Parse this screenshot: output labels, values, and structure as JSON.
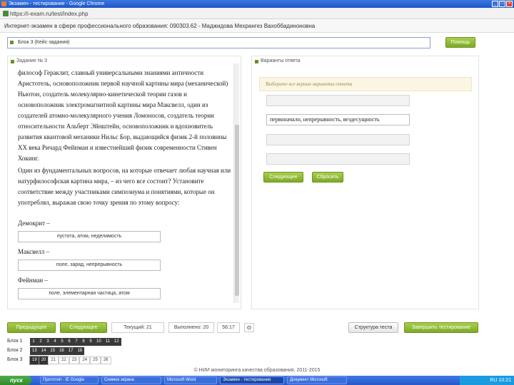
{
  "browser": {
    "title": "Экзамен - тестирование - Google Chrome",
    "address": "https://i-exam.ru/test/index.php"
  },
  "header": {
    "text": "Интернет-экзамен в сфере профессионального образования: 090303.62 - Маджидова Мехрангез Вахоббадиноновна"
  },
  "block_field": {
    "value": "Блок 3 (Кейс-задания)"
  },
  "help_button": "Помощь",
  "task_panel": {
    "title": "Задание № 3",
    "paragraphs": [
      "философ Гераклит, славный универсальными знаниями античности Аристотель, основоположник первой научной картины мира (механической) Ньютон, создатель молекулярно-кинетической теории газов и основоположник электромагнитной картины мира Максвелл, один из создателей атомно-молекулярного учения Ломоносов, создатель теории относительности Альберт Эйнштейн, основоположник и вдохновитель развития квантовой механики Нильс Бор, выдающийся физик 2-й половины XX века Ричард Фейнман и известнейший физик современности Стивен Хокинг.",
      "Один из фундаментальных вопросов, на которые отвечает любая научная или натурфилософская картина мира, – из чего все состоит? Установите соответствие между участниками симпозиума и понятиями, которые он употреблял, выражая свою точку зрения по этому вопросу:"
    ],
    "matches": [
      {
        "name": "Демокрит –",
        "answer": "пустота, атом, неделимость"
      },
      {
        "name": "Максвелл –",
        "answer": "поле, заряд, непрерывность"
      },
      {
        "name": "Фейнман –",
        "answer": "поле, элементарная частица, атом"
      }
    ]
  },
  "answer_panel": {
    "title": "Варианты ответа",
    "hint": "Выберите все верные варианты ответа",
    "slots": [
      "",
      "первоначало, непрерывность, вездесущность",
      "",
      ""
    ],
    "next_label": "Следующее",
    "reset_label": "Сбросить"
  },
  "navigation": {
    "prev_label": "Предыдущее",
    "next_label": "Следующее",
    "current_counter": "Текущий: 21",
    "answered_counter": "Выполнено: 20",
    "time": "56:17",
    "timer_icon": "clock-icon",
    "structure_label": "Структура теста",
    "finish_label": "Завершить тестирование"
  },
  "blocks": [
    {
      "name": "Блок 1",
      "questions": [
        "1",
        "2",
        "3",
        "4",
        "5",
        "6",
        "7",
        "8",
        "9",
        "10",
        "11",
        "12"
      ]
    },
    {
      "name": "Блок 2",
      "questions": [
        "13",
        "14",
        "15",
        "16",
        "17",
        "18"
      ]
    },
    {
      "name": "Блок 3",
      "questions": [
        "19",
        "20",
        "21",
        "22",
        "23",
        "24",
        "25",
        "26"
      ]
    }
  ],
  "footer": "© НИИ мониторинга качества образования, 2011-2015",
  "taskbar": {
    "start": "пуск",
    "tasks": [
      "Прототип - IE Google",
      "Снимок экрана",
      "Microsoft Word",
      "Экзамен - тестирование",
      "Документ Microsoft"
    ],
    "clock": "RU 10:21"
  },
  "colors": {
    "accent_green": "#8bbb35",
    "hint_background": "#fbf6e3",
    "taskbar_blue": "#2a5fd4"
  }
}
